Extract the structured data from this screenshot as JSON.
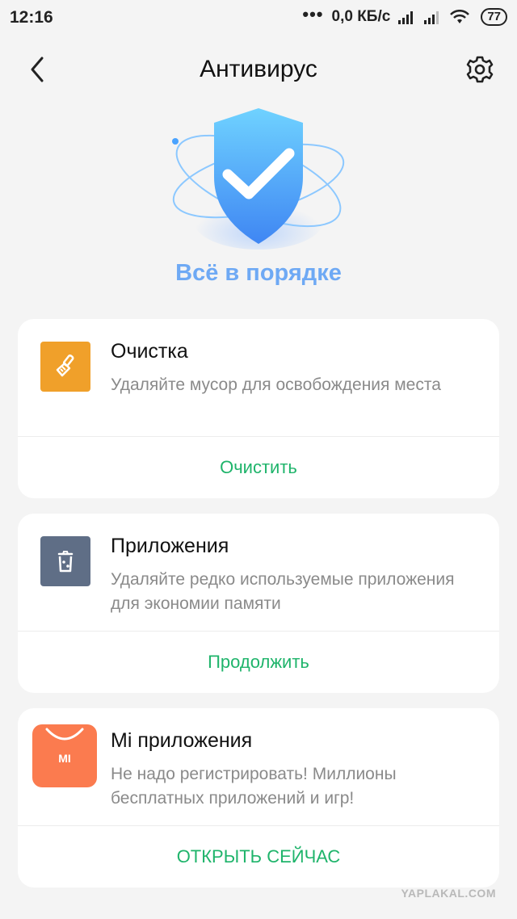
{
  "status_bar": {
    "time": "12:16",
    "dots": "•••",
    "network_speed": "0,0 КБ/с",
    "battery": "77"
  },
  "header": {
    "title": "Антивирус"
  },
  "hero": {
    "status": "Всё в порядке"
  },
  "cards": [
    {
      "title": "Очистка",
      "description": "Удаляйте мусор для освобождения места",
      "action": "Очистить",
      "icon": "broom-icon",
      "icon_color": "#f0a02a"
    },
    {
      "title": "Приложения",
      "description": "Удаляйте редко используемые приложения для экономии памяти",
      "action": "Продолжить",
      "icon": "trash-apps-icon",
      "icon_color": "#5f6e86"
    },
    {
      "title": "Mi приложения",
      "description": "Не надо регистрировать! Миллионы бесплатных приложений и игр!",
      "action": "ОТКРЫТЬ СЕЙЧАС",
      "icon": "mi-store-icon",
      "icon_color": "#fb7b4f",
      "icon_text": "MI"
    }
  ],
  "watermark": "YAPLAKAL.COM",
  "colors": {
    "accent_green": "#1fb46b",
    "status_blue": "#6ea9f4"
  }
}
